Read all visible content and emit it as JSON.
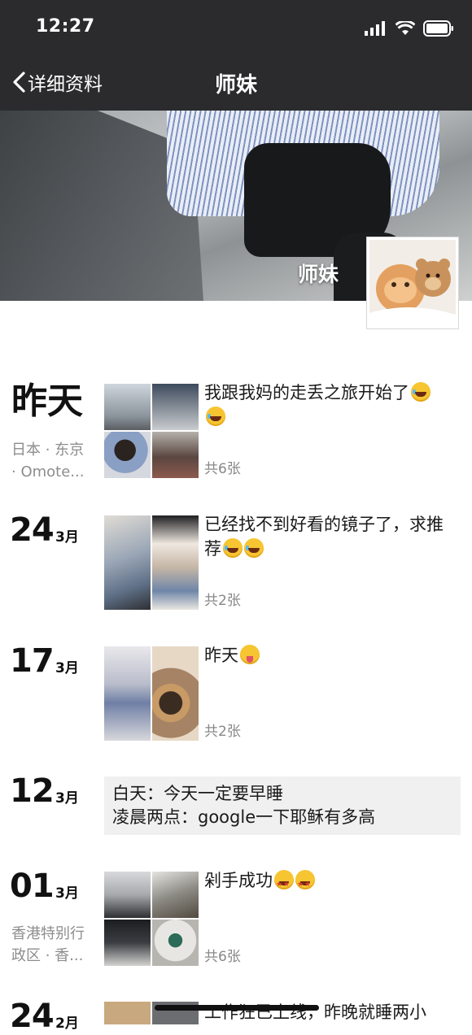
{
  "status_bar": {
    "time": "12:27"
  },
  "nav": {
    "back_label": "详细资料",
    "title": "师妹"
  },
  "profile": {
    "name": "师妹"
  },
  "posts": [
    {
      "date_word": "昨天",
      "location": [
        "日本 · 东京",
        "· Omote..."
      ],
      "text": "我跟我妈的走丢之旅开始了",
      "emojis": [
        "laugh",
        "laugh"
      ],
      "count": "共6张"
    },
    {
      "day": "24",
      "month": "3月",
      "text": "已经找不到好看的镜子了，求推荐",
      "emojis": [
        "laugh",
        "laugh"
      ],
      "count": "共2张"
    },
    {
      "day": "17",
      "month": "3月",
      "text": "昨天",
      "emojis": [
        "tongue"
      ],
      "count": "共2张"
    },
    {
      "day": "12",
      "month": "3月",
      "text_lines": [
        "白天：今天一定要早睡",
        "凌晨两点：google一下耶稣有多高"
      ]
    },
    {
      "day": "01",
      "month": "3月",
      "location": [
        "香港特别行",
        "政区 · 香..."
      ],
      "text": "剁手成功",
      "emojis": [
        "star",
        "star"
      ],
      "count": "共6张"
    },
    {
      "day": "24",
      "month": "2月",
      "text": "工作狂已上线，昨晚就睡两小"
    }
  ],
  "colors": {
    "nav_bg": "#2b2b2d",
    "text_box_bg": "#f0f0f1",
    "meta_gray": "#888888"
  }
}
